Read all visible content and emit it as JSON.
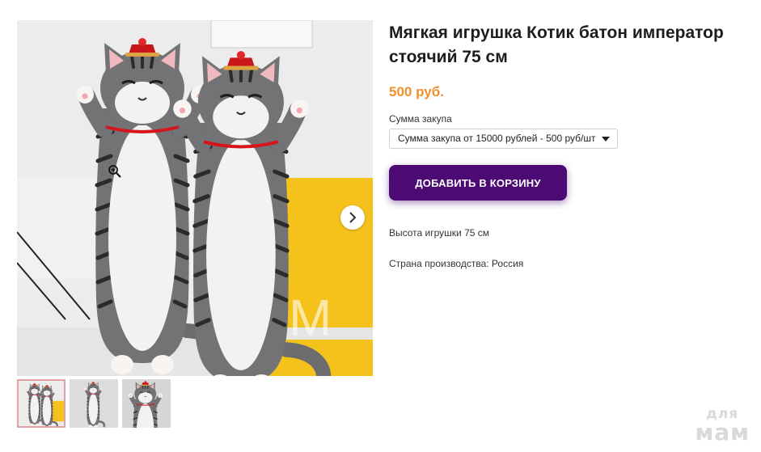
{
  "product": {
    "title": "Мягкая игрушка Котик батон император стоячий 75 см",
    "price": "500 руб.",
    "option_label": "Сумма закупа",
    "option_selected": "Сумма закупа от 15000 рублей - 500 руб/шт",
    "add_to_cart_label": "ДОБАВИТЬ В КОРЗИНУ",
    "specs": [
      "Высота игрушки 75 см",
      "Страна производства: Россия"
    ]
  },
  "gallery": {
    "thumbnail_count": 3,
    "active_index": 0
  },
  "watermark": {
    "line1": "для",
    "line2": "мам"
  },
  "colors": {
    "price": "#f0902e",
    "button": "#4c0a74",
    "accent_yellow": "#f5c21c"
  },
  "icons": [
    "zoom-in-icon",
    "chevron-right-icon",
    "dropdown-caret-icon"
  ]
}
